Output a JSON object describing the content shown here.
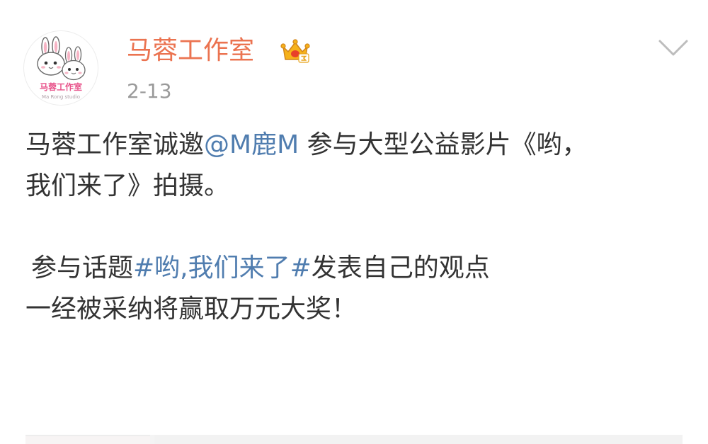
{
  "author": {
    "name": "马蓉工作室",
    "avatar_text": "马蓉工作室",
    "avatar_subtext": "Ma Rong studio",
    "badge_icon": "crown-vip-icon",
    "name_color": "#eb7350"
  },
  "post": {
    "time": "2-13",
    "line1_prefix": "马蓉工作室诚邀",
    "mention": "@M鹿M",
    "line1_suffix": " 参与大型公益影片《哟，",
    "line2": "我们来了》拍摄。",
    "line3_prefix": "参与话题",
    "topic": "#哟,我们来了#",
    "line3_suffix": "发表自己的观点",
    "line4": "一经被采纳将赢取万元大奖！",
    "link_color": "#507daf"
  },
  "menu": {
    "icon": "chevron-down-icon"
  }
}
